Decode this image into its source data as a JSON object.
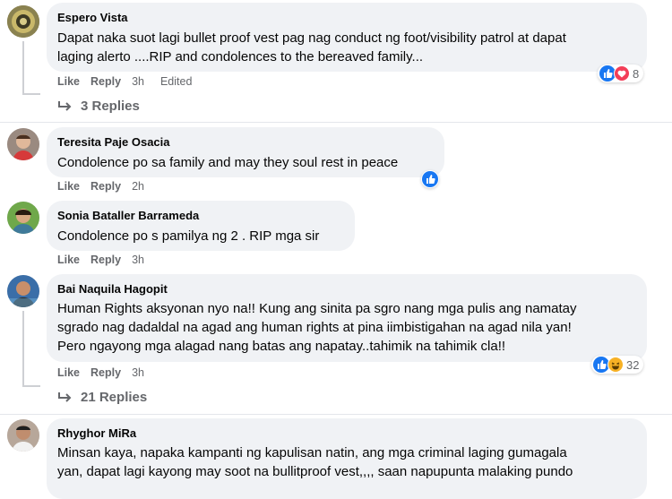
{
  "comments": [
    {
      "author": "Espero Vista",
      "lines": [
        "Dapat naka suot lagi bullet proof vest pag nag conduct ng foot/visibility patrol at dapat",
        "laging alerto ....RIP and condolences to the bereaved family..."
      ],
      "like": "Like",
      "reply": "Reply",
      "time": "3h",
      "edited": "Edited",
      "reaction_count": "8",
      "replies": "3 Replies"
    },
    {
      "author": "Teresita Paje Osacia",
      "lines": [
        "Condolence po sa family and may they soul rest in peace"
      ],
      "like": "Like",
      "reply": "Reply",
      "time": "2h"
    },
    {
      "author": "Sonia Bataller Barrameda",
      "lines": [
        "Condolence po s pamilya ng 2 . RIP mga sir"
      ],
      "like": "Like",
      "reply": "Reply",
      "time": "3h"
    },
    {
      "author": "Bai Naquila Hagopit",
      "lines": [
        "Human Rights aksyonan nyo na!! Kung ang sinita pa sgro nang mga pulis ang namatay",
        "sgrado nag dadaldal na agad ang human rights at pina iimbistigahan na agad nila yan!",
        "Pero ngayong mga alagad nang batas ang napatay..tahimik na tahimik cla!!"
      ],
      "like": "Like",
      "reply": "Reply",
      "time": "3h",
      "reaction_count": "32",
      "replies": "21 Replies"
    },
    {
      "author": "Rhyghor MiRa",
      "lines": [
        "Minsan kaya, napaka kampanti ng kapulisan natin, ang mga criminal laging gumagala",
        "yan, dapat lagi kayong may soot na bullitproof vest,,,, saan napupunta malaking pundo"
      ]
    }
  ],
  "colors": {
    "bubble": "#f0f2f5",
    "meta": "#65676b",
    "like_blue": "#1877f2",
    "love_red": "#f33e58",
    "haha_yellow": "#f7b125"
  }
}
